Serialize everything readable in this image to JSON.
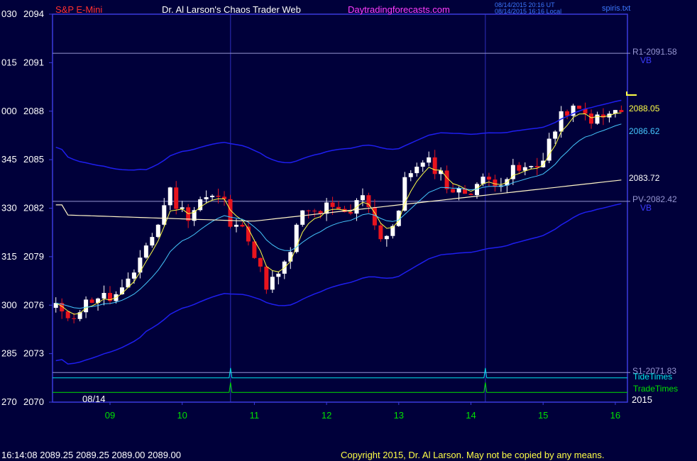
{
  "header": {
    "symbol": "S&P E-Mini",
    "title": "Dr. Al Larson's Chaos Trader Web",
    "site": "Daytradingforecasts.com",
    "stamp_utc": "08/14/2015 20:16 UT",
    "stamp_local": "08/14/2015 16:16 Local",
    "file": "spiris.txt"
  },
  "footer": {
    "quote": "16:14:08  2089.25  2089.25  2089.00  2089.00",
    "copyright": "Copyright 2015, Dr. Al Larson. May not be copied by any means."
  },
  "colors": {
    "background": "#00003a",
    "frame": "#3a3adc",
    "up_candle": "#ffffff",
    "down_candle": "#e8141e",
    "ma_fast": "#ffff46",
    "ma_mid": "#46c8ff",
    "ma_slow": "#fff5c8",
    "bands": "#1e1ef0",
    "tide_times": "#00e6e6",
    "trade_times": "#00e100",
    "level_lines": "#9696d2"
  },
  "chart_data": {
    "type": "candlestick",
    "title": "S&P E-Mini",
    "date": "08/14",
    "year": "2015",
    "interval_minutes": 5,
    "ylim": [
      2070,
      2094
    ],
    "yticks": [
      {
        "price": 2094,
        "degree": "030",
        "label": "2094"
      },
      {
        "price": 2091,
        "degree": "015",
        "label": "2091"
      },
      {
        "price": 2088,
        "degree": "000",
        "label": "2088"
      },
      {
        "price": 2085,
        "degree": "345",
        "label": "2085"
      },
      {
        "price": 2082,
        "degree": "330",
        "label": "2082"
      },
      {
        "price": 2079,
        "degree": "315",
        "label": "2079"
      },
      {
        "price": 2076,
        "degree": "300",
        "label": "2076"
      },
      {
        "price": 2073,
        "degree": "285",
        "label": "2073"
      },
      {
        "price": 2070,
        "degree": "270",
        "label": "2070"
      }
    ],
    "xlim_hours": [
      8.25,
      16.1
    ],
    "xticks": [
      9,
      10,
      11,
      12,
      13,
      14,
      15,
      16
    ],
    "xtick_labels": [
      "09",
      "10",
      "11",
      "12",
      "13",
      "14",
      "15",
      "16"
    ],
    "vertical_marker_hours": [
      10.67,
      14.2
    ],
    "levels": [
      {
        "name": "R1",
        "label": "R1-2091.58",
        "value": 2091.58
      },
      {
        "name": "PV",
        "label": "PV-2082.42",
        "value": 2082.42
      },
      {
        "name": "S1",
        "label": "S1-2071.83",
        "value": 2071.83
      }
    ],
    "band_labels": [
      "VB",
      "VB"
    ],
    "value_labels": [
      {
        "series": "ma_fast",
        "value": 2088.05,
        "label": "2088.05"
      },
      {
        "series": "ma_mid",
        "value": 2086.62,
        "label": "2086.62"
      },
      {
        "series": "ma_slow",
        "value": 2083.72,
        "label": "2083.72"
      }
    ],
    "last_price_marker": 2089.0,
    "timing_lines": [
      {
        "name": "TideTimes",
        "peaks_hours": [
          10.67,
          14.2
        ]
      },
      {
        "name": "TradeTimes",
        "peaks_hours": [
          10.67,
          14.2
        ]
      }
    ],
    "close_anchors": [
      [
        8.25,
        2076.0
      ],
      [
        8.3,
        2075.2
      ],
      [
        8.5,
        2075.5
      ],
      [
        8.8,
        2076.6
      ],
      [
        9.0,
        2076.4
      ],
      [
        9.15,
        2076.7
      ],
      [
        9.3,
        2077.5
      ],
      [
        9.4,
        2079.0
      ],
      [
        9.55,
        2080.1
      ],
      [
        9.65,
        2080.6
      ],
      [
        9.8,
        2083.3
      ],
      [
        9.9,
        2082.4
      ],
      [
        10.0,
        2081.8
      ],
      [
        10.1,
        2081.6
      ],
      [
        10.25,
        2082.6
      ],
      [
        10.45,
        2082.7
      ],
      [
        10.6,
        2082.3
      ],
      [
        10.7,
        2080.3
      ],
      [
        10.85,
        2081.4
      ],
      [
        11.0,
        2079.0
      ],
      [
        11.15,
        2077.3
      ],
      [
        11.3,
        2077.6
      ],
      [
        11.45,
        2078.6
      ],
      [
        11.6,
        2081.0
      ],
      [
        11.7,
        2081.9
      ],
      [
        11.8,
        2081.6
      ],
      [
        12.0,
        2082.0
      ],
      [
        12.2,
        2081.6
      ],
      [
        12.35,
        2081.7
      ],
      [
        12.5,
        2083.0
      ],
      [
        12.6,
        2082.2
      ],
      [
        12.7,
        2080.3
      ],
      [
        12.85,
        2080.4
      ],
      [
        13.0,
        2081.5
      ],
      [
        13.1,
        2084.5
      ],
      [
        13.25,
        2084.4
      ],
      [
        13.4,
        2084.8
      ],
      [
        13.55,
        2084.4
      ],
      [
        13.7,
        2083.2
      ],
      [
        13.85,
        2082.9
      ],
      [
        14.0,
        2083.2
      ],
      [
        14.1,
        2083.6
      ],
      [
        14.25,
        2083.7
      ],
      [
        14.45,
        2083.8
      ],
      [
        14.6,
        2084.3
      ],
      [
        14.8,
        2084.4
      ],
      [
        14.95,
        2084.6
      ],
      [
        15.05,
        2086.0
      ],
      [
        15.2,
        2087.0
      ],
      [
        15.3,
        2088.1
      ],
      [
        15.45,
        2088.0
      ],
      [
        15.6,
        2087.7
      ],
      [
        15.8,
        2087.4
      ],
      [
        15.95,
        2087.9
      ],
      [
        16.1,
        2088.0
      ]
    ]
  }
}
